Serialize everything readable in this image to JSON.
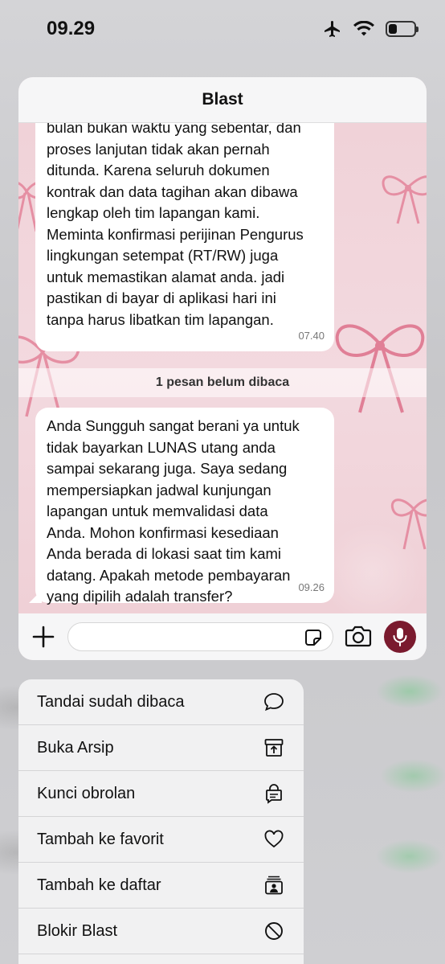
{
  "status_bar": {
    "time": "09.29",
    "icons": [
      "airplane-icon",
      "wifi-icon",
      "battery-icon"
    ]
  },
  "chat": {
    "title": "Blast",
    "messages": [
      {
        "lines": [
          "bulan bukan waktu yang sebentar, dan",
          "proses lanjutan tidak akan pernah",
          "ditunda. Karena seluruh dokumen",
          "kontrak dan data tagihan akan dibawa",
          "lengkap oleh tim lapangan kami.",
          "Meminta konfirmasi perijinan Pengurus",
          "lingkungan setempat (RT/RW) juga",
          "untuk memastikan alamat anda. jadi",
          "pastikan di bayar di aplikasi hari ini",
          "tanpa harus libatkan tim lapangan."
        ],
        "time": "07.40"
      },
      {
        "lines": [
          "Anda Sungguh sangat berani ya untuk",
          "tidak bayarkan LUNAS utang anda",
          "sampai sekarang juga. Saya sedang",
          "mempersiapkan jadwal kunjungan",
          "lapangan untuk memvalidasi data",
          "Anda. Mohon konfirmasi kesediaan",
          "Anda berada di lokasi saat tim kami",
          "datang. Apakah metode pembayaran",
          "yang dipilih adalah transfer?"
        ],
        "time": "09.26"
      }
    ],
    "unread_banner": "1 pesan belum dibaca",
    "accent_color": "#7a1a2e"
  },
  "input_bar": {
    "icons": [
      "plus-icon",
      "sticker-icon",
      "camera-icon",
      "microphone-icon"
    ]
  },
  "context_menu": {
    "items": [
      {
        "label": "Tandai sudah dibaca",
        "icon": "chat-bubble-icon"
      },
      {
        "label": "Buka Arsip",
        "icon": "archive-icon"
      },
      {
        "label": "Kunci obrolan",
        "icon": "lock-chat-icon"
      },
      {
        "label": "Tambah ke favorit",
        "icon": "heart-icon"
      },
      {
        "label": "Tambah ke daftar",
        "icon": "list-person-icon"
      },
      {
        "label": "Blokir Blast",
        "icon": "block-icon"
      }
    ]
  }
}
